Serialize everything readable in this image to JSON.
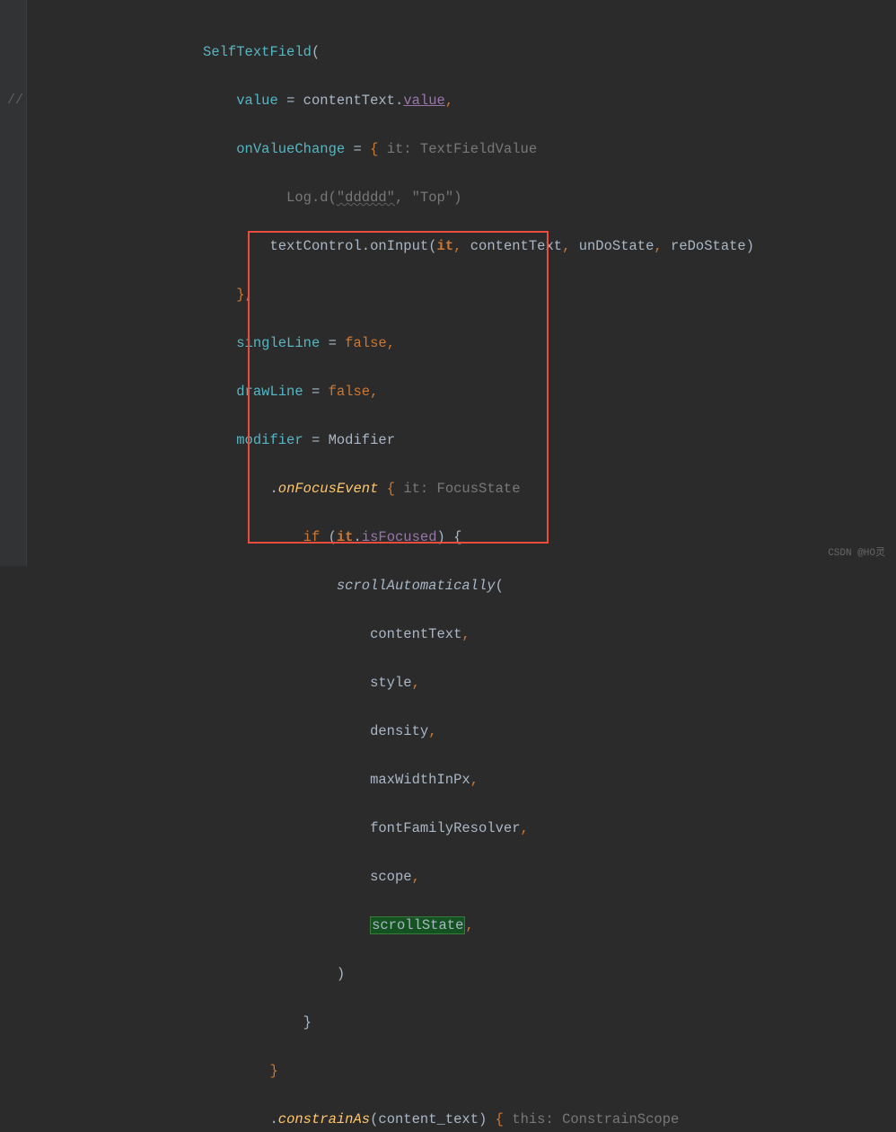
{
  "gutter": {
    "comment": "//"
  },
  "code": {
    "l1": {
      "indent": "                    ",
      "fn": "SelfTextField",
      "paren": "("
    },
    "l2": {
      "indent": "                        ",
      "param": "value",
      "eq": " = ",
      "obj": "contentText",
      "dot": ".",
      "prop": "value",
      "comma": ","
    },
    "l3": {
      "indent": "                        ",
      "param": "onValueChange",
      "eq": " = ",
      "brace": "{",
      "hint": " it: TextFieldValue "
    },
    "l4": {
      "indent": "                              ",
      "fn": "Log.d",
      "p1": "(",
      "str1": "\"ddddd\"",
      "comma1": ", ",
      "str2": "\"Top\"",
      "p2": ")"
    },
    "l5": {
      "indent": "                            ",
      "obj": "textControl",
      "dot": ".",
      "method": "onInput",
      "p1": "(",
      "arg1": "it",
      "c1": ", ",
      "arg2": "contentText",
      "c2": ", ",
      "arg3": "unDoState",
      "c3": ", ",
      "arg4": "reDoState",
      "p2": ")"
    },
    "l6": {
      "indent": "                        ",
      "brace": "}",
      "comma": ","
    },
    "l7": {
      "indent": "                        ",
      "param": "singleLine",
      "eq": " = ",
      "val": "false",
      "comma": ","
    },
    "l8": {
      "indent": "                        ",
      "param": "drawLine",
      "eq": " = ",
      "val": "false",
      "comma": ","
    },
    "l9": {
      "indent": "                        ",
      "param": "modifier",
      "eq": " = ",
      "val": "Modifier"
    },
    "l10": {
      "indent": "                            ",
      "dot": ".",
      "method": "onFocusEvent",
      "space": " ",
      "brace": "{",
      "hint": " it: FocusState "
    },
    "l11": {
      "indent": "                                ",
      "kw": "if",
      "sp": " (",
      "obj": "it",
      "dot": ".",
      "prop": "isFocused",
      "p2": ") {"
    },
    "l12": {
      "indent": "                                    ",
      "fn": "scrollAutomatically",
      "p": "("
    },
    "l13": {
      "indent": "                                        ",
      "arg": "contentText",
      "comma": ","
    },
    "l14": {
      "indent": "                                        ",
      "arg": "style",
      "comma": ","
    },
    "l15": {
      "indent": "                                        ",
      "arg": "density",
      "comma": ","
    },
    "l16": {
      "indent": "                                        ",
      "arg": "maxWidthInPx",
      "comma": ","
    },
    "l17": {
      "indent": "                                        ",
      "arg": "fontFamilyResolver",
      "comma": ","
    },
    "l18": {
      "indent": "                                        ",
      "arg": "scope",
      "comma": ","
    },
    "l19": {
      "indent": "                                        ",
      "arg": "scrollState",
      "comma": ","
    },
    "l20": {
      "indent": "                                    ",
      "p": ")"
    },
    "l21": {
      "indent": "                                ",
      "brace": "}"
    },
    "l22": {
      "indent": "                            ",
      "brace": "}"
    },
    "l23": {
      "indent": "                            ",
      "dot": ".",
      "method": "constrainAs",
      "p1": "(",
      "arg": "content_text",
      "p2": ")",
      "sp": " ",
      "brace": "{",
      "hint": " this: ConstrainScope "
    }
  },
  "watermark": "CSDN @HO灵"
}
